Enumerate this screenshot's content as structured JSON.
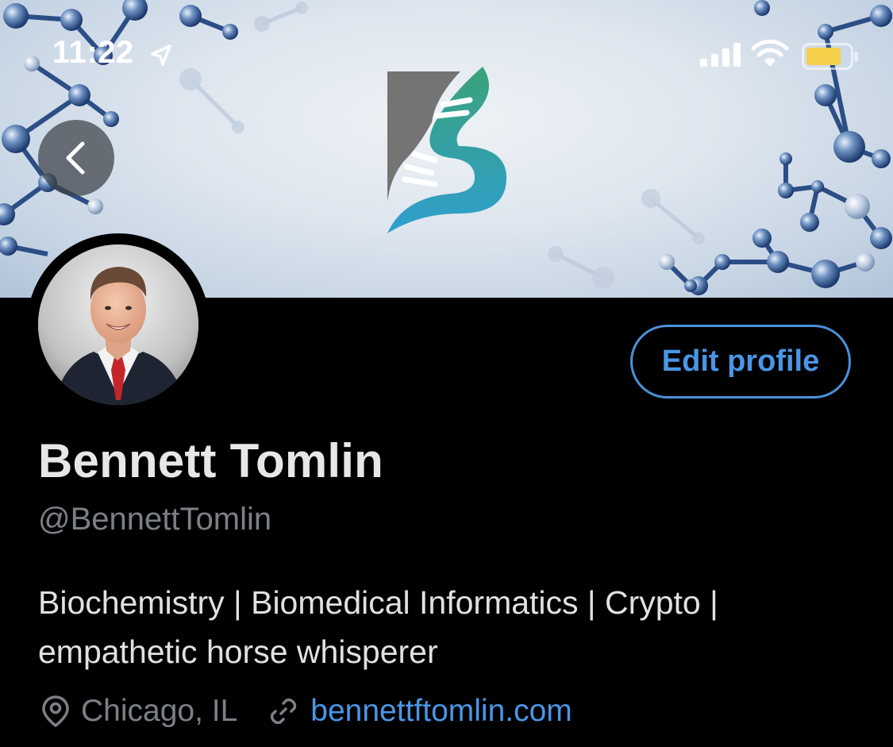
{
  "status_bar": {
    "time": "11:22",
    "battery_color": "#f5d04a",
    "icons": [
      "location-arrow-icon",
      "signal-icon",
      "wifi-icon",
      "battery-icon"
    ]
  },
  "banner": {
    "logo_letter": "S",
    "logo_colors": [
      "#6b6b6b",
      "#3aa37a",
      "#2f9ecf"
    ]
  },
  "navigation": {
    "back_icon": "chevron-left-icon"
  },
  "profile": {
    "name": "Bennett Tomlin",
    "handle": "@BennettTomlin",
    "bio": "Biochemistry | Biomedical Informatics | Crypto | empathetic horse whisperer",
    "location": "Chicago, IL",
    "website": "bennettftomlin.com",
    "edit_label": "Edit profile"
  },
  "colors": {
    "accent": "#4a96e6",
    "background": "#000000",
    "secondary_text": "#7b8087"
  }
}
